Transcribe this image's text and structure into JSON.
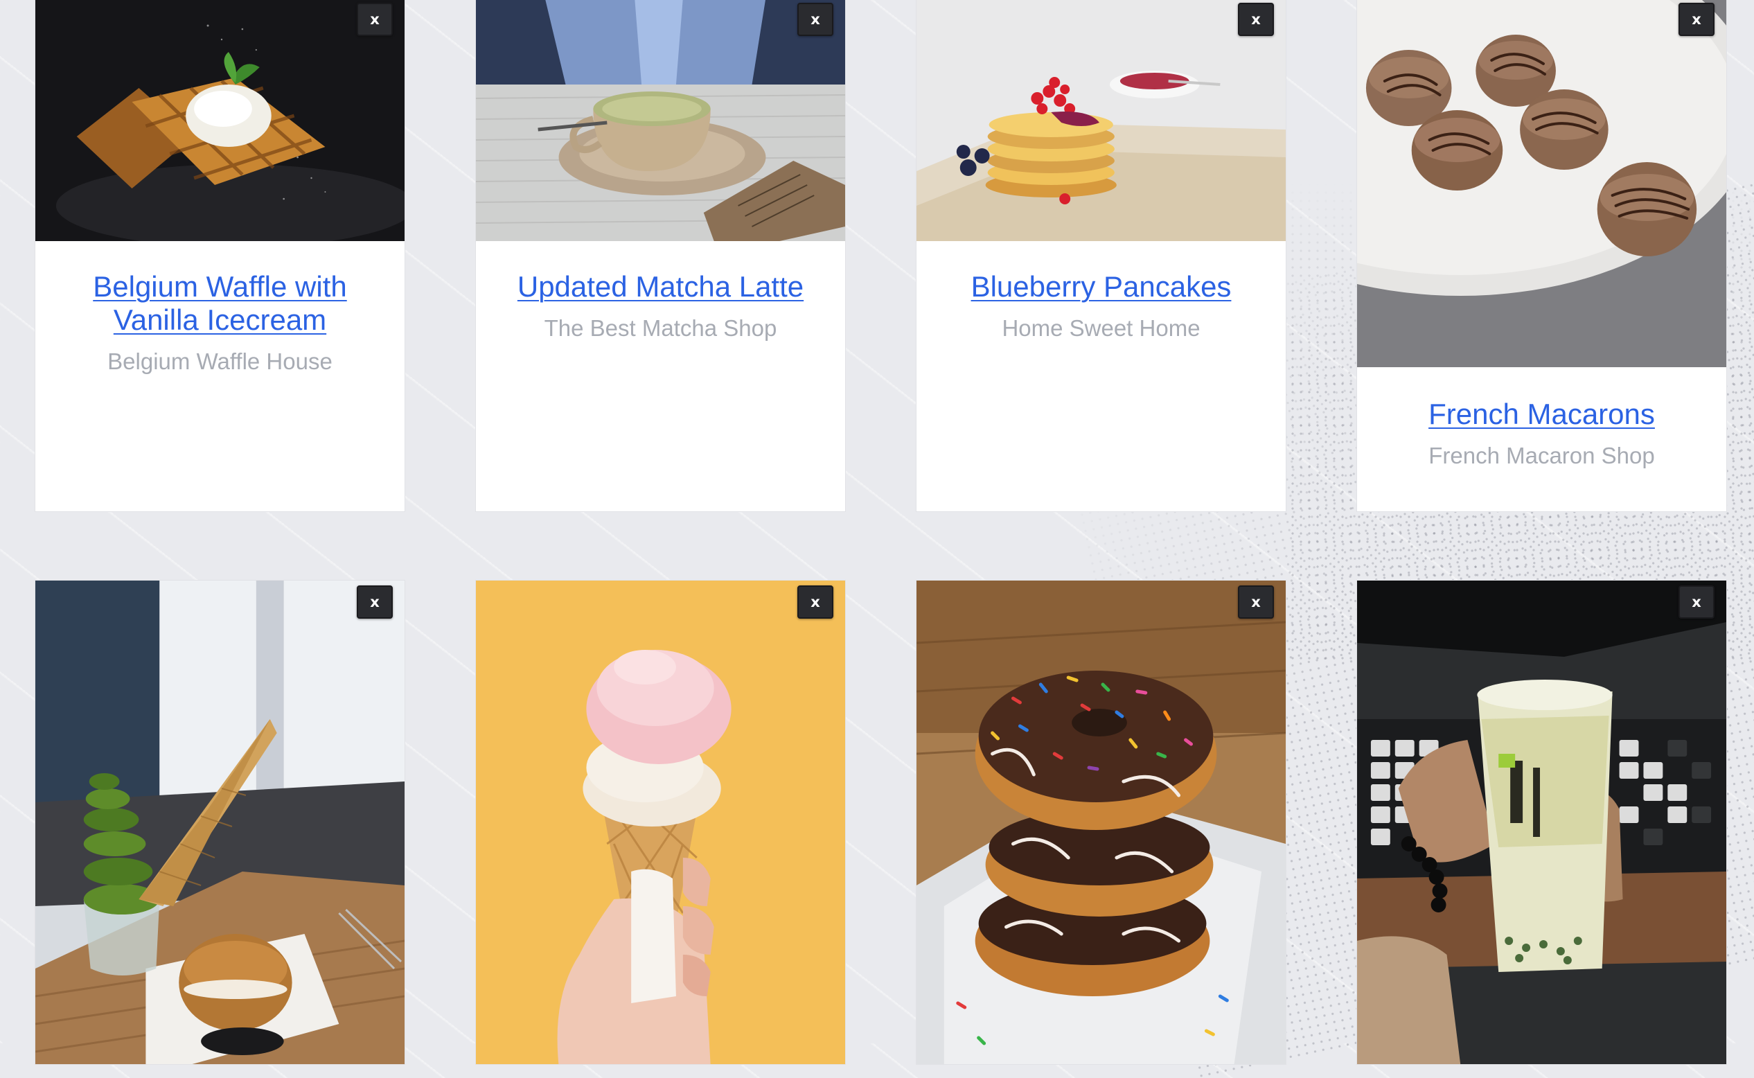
{
  "close_label": "x",
  "cards": [
    {
      "title": "Belgium Waffle with Vanilla Icecream",
      "subtitle": "Belgium Waffle House",
      "image_icon": "waffle-photo"
    },
    {
      "title": "Updated Matcha Latte",
      "subtitle": "The Best Matcha Shop",
      "image_icon": "matcha-latte-photo"
    },
    {
      "title": "Blueberry Pancakes",
      "subtitle": "Home Sweet Home",
      "image_icon": "pancakes-photo"
    },
    {
      "title": "French Macarons",
      "subtitle": "French Macaron Shop",
      "image_icon": "macarons-photo"
    },
    {
      "image_icon": "matcha-softserve-photo"
    },
    {
      "image_icon": "icecream-cone-photo"
    },
    {
      "image_icon": "donuts-photo"
    },
    {
      "image_icon": "bubble-tea-photo"
    }
  ],
  "colors": {
    "link": "#2b62e3",
    "subtitle": "#a7abb3",
    "close_button": "#2a2b2f",
    "background": "#e9eaee"
  }
}
